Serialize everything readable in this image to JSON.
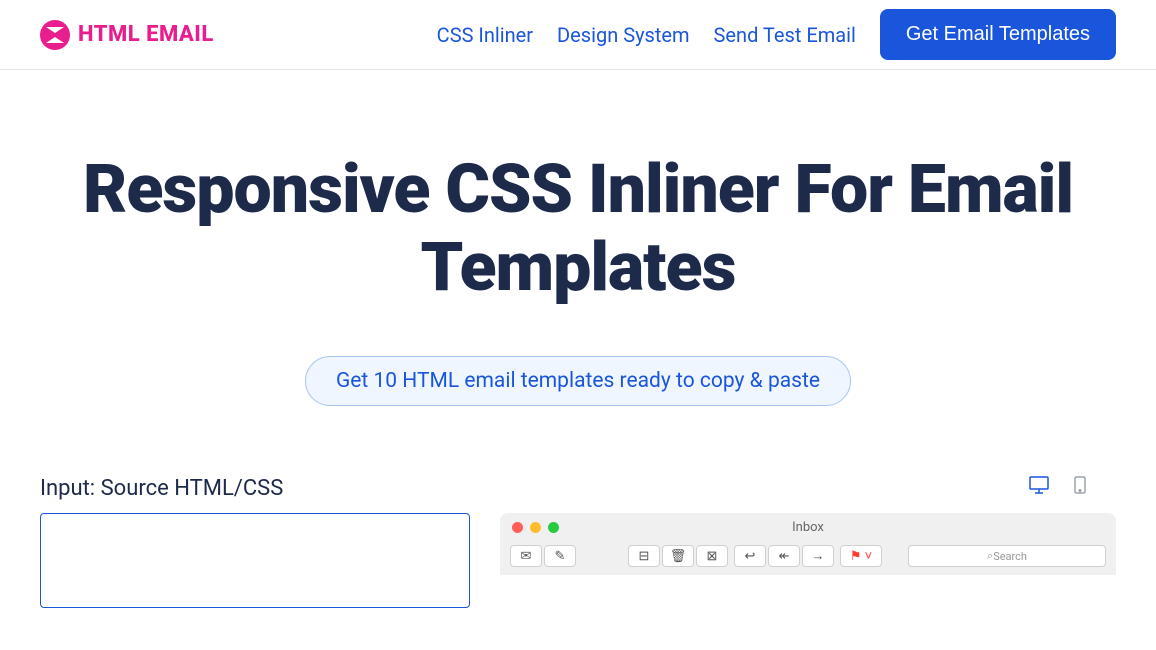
{
  "logo": {
    "text": "HTML EMAIL"
  },
  "nav": {
    "links": [
      "CSS Inliner",
      "Design System",
      "Send Test Email"
    ],
    "cta": "Get Email Templates"
  },
  "hero": {
    "title": "Responsive CSS Inliner For Email Templates",
    "cta": "Get 10 HTML email templates ready to copy & paste"
  },
  "input": {
    "label": "Input: Source HTML/CSS"
  },
  "preview": {
    "window_title": "Inbox",
    "search_placeholder": "Search"
  }
}
